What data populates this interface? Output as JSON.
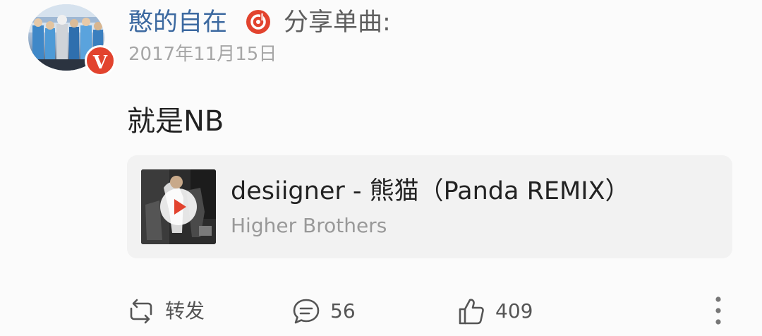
{
  "post": {
    "username": "憨的自在",
    "share_text": "分享单曲:",
    "date": "2017年11月15日",
    "verified_badge": "V",
    "text": "就是NB"
  },
  "song": {
    "title": "desiigner - 熊猫（Panda REMIX）",
    "artist": "Higher Brothers"
  },
  "actions": {
    "repost_label": "转发",
    "comment_count": "56",
    "like_count": "409"
  },
  "colors": {
    "username": "#3c69a0",
    "verified_badge": "#e2432e",
    "music_badge": "#e2432e",
    "play_triangle": "#e2432e"
  },
  "icons": {
    "music": "music-disc-icon",
    "play": "play-icon",
    "repost": "repost-icon",
    "comment": "comment-icon",
    "like": "thumbs-up-icon",
    "more": "more-vertical-icon"
  }
}
